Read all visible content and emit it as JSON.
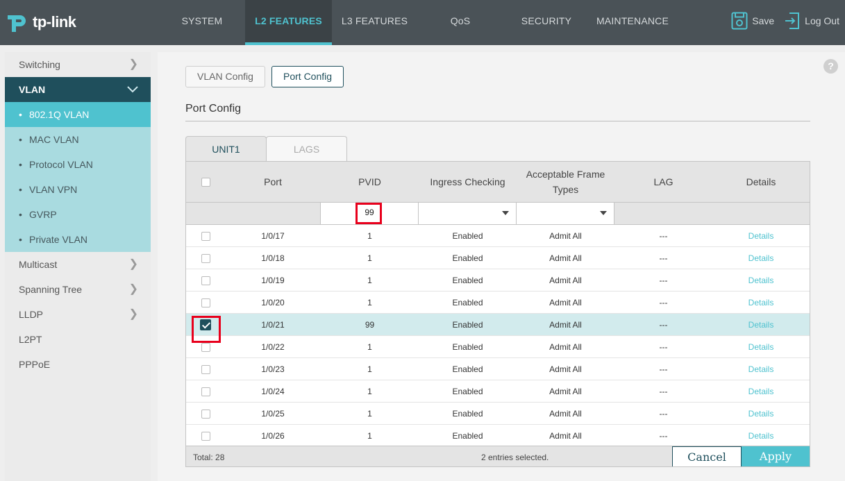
{
  "brand": {
    "logo_text": "tp-link"
  },
  "nav": [
    {
      "label": "SYSTEM"
    },
    {
      "label": "L2 FEATURES",
      "active": true
    },
    {
      "label": "L3 FEATURES"
    },
    {
      "label": "QoS"
    },
    {
      "label": "SECURITY"
    },
    {
      "label": "MAINTENANCE"
    }
  ],
  "actions": {
    "save": "Save",
    "logout": "Log Out"
  },
  "sidebar": {
    "items": [
      {
        "label": "Switching"
      },
      {
        "label": "VLAN"
      },
      {
        "label": "Multicast"
      },
      {
        "label": "Spanning Tree"
      },
      {
        "label": "LLDP"
      },
      {
        "label": "L2PT"
      },
      {
        "label": "PPPoE"
      }
    ],
    "vlan_sub": [
      {
        "label": "802.1Q VLAN"
      },
      {
        "label": "MAC VLAN"
      },
      {
        "label": "Protocol VLAN"
      },
      {
        "label": "VLAN VPN"
      },
      {
        "label": "GVRP"
      },
      {
        "label": "Private VLAN"
      }
    ]
  },
  "subtabs": {
    "vlan_config": "VLAN Config",
    "port_config": "Port Config"
  },
  "section_title": "Port Config",
  "unit_tabs": {
    "unit1": "UNIT1",
    "lags": "LAGS"
  },
  "table": {
    "headers": {
      "port": "Port",
      "pvid": "PVID",
      "ingress": "Ingress Checking",
      "frame_line1": "Acceptable Frame",
      "frame_line2": "Types",
      "lag": "LAG",
      "details": "Details"
    },
    "filter": {
      "pvid": "99"
    },
    "rows": [
      {
        "port": "1/0/17",
        "pvid": "1",
        "ingress": "Enabled",
        "frame": "Admit All",
        "lag": "---",
        "details": "Details"
      },
      {
        "port": "1/0/18",
        "pvid": "1",
        "ingress": "Enabled",
        "frame": "Admit All",
        "lag": "---",
        "details": "Details"
      },
      {
        "port": "1/0/19",
        "pvid": "1",
        "ingress": "Enabled",
        "frame": "Admit All",
        "lag": "---",
        "details": "Details"
      },
      {
        "port": "1/0/20",
        "pvid": "1",
        "ingress": "Enabled",
        "frame": "Admit All",
        "lag": "---",
        "details": "Details"
      },
      {
        "port": "1/0/21",
        "pvid": "99",
        "ingress": "Enabled",
        "frame": "Admit All",
        "lag": "---",
        "details": "Details"
      },
      {
        "port": "1/0/22",
        "pvid": "1",
        "ingress": "Enabled",
        "frame": "Admit All",
        "lag": "---",
        "details": "Details"
      },
      {
        "port": "1/0/23",
        "pvid": "1",
        "ingress": "Enabled",
        "frame": "Admit All",
        "lag": "---",
        "details": "Details"
      },
      {
        "port": "1/0/24",
        "pvid": "1",
        "ingress": "Enabled",
        "frame": "Admit All",
        "lag": "---",
        "details": "Details"
      },
      {
        "port": "1/0/25",
        "pvid": "1",
        "ingress": "Enabled",
        "frame": "Admit All",
        "lag": "---",
        "details": "Details"
      },
      {
        "port": "1/0/26",
        "pvid": "1",
        "ingress": "Enabled",
        "frame": "Admit All",
        "lag": "---",
        "details": "Details"
      }
    ],
    "footer": {
      "total": "Total: 28",
      "selected": "2 entries selected."
    }
  },
  "buttons": {
    "cancel": "Cancel",
    "apply": "Apply"
  },
  "colors": {
    "accent": "#4fc2cf",
    "dark_teal": "#1f4f5c",
    "topbar": "#4a5257",
    "highlight": "#e8001c"
  },
  "icons": {
    "save": "save-gear-icon",
    "logout": "logout-arrow-icon",
    "help": "help-icon"
  }
}
